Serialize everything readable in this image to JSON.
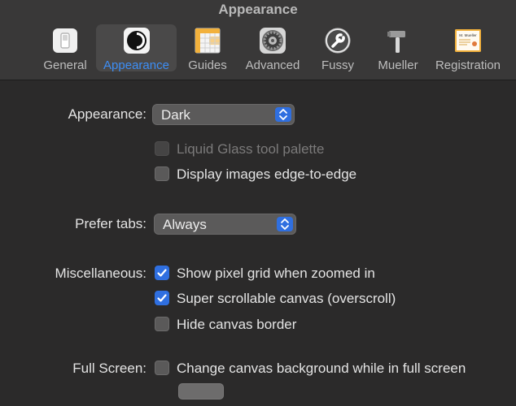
{
  "window": {
    "title": "Appearance"
  },
  "toolbar": {
    "tabs": [
      {
        "label": "General",
        "icon": "switch-icon",
        "active": false
      },
      {
        "label": "Appearance",
        "icon": "contrast-icon",
        "active": true
      },
      {
        "label": "Guides",
        "icon": "grid-sheet-icon",
        "active": false
      },
      {
        "label": "Advanced",
        "icon": "gear-icon",
        "active": false
      },
      {
        "label": "Fussy",
        "icon": "wrench-icon",
        "active": false
      },
      {
        "label": "Mueller",
        "icon": "hammer-icon",
        "active": false
      },
      {
        "label": "Registration",
        "icon": "certificate-icon",
        "active": false
      }
    ],
    "certificate_text": "M. Mueller"
  },
  "appearance": {
    "label": "Appearance:",
    "value": "Dark",
    "liquid_glass": {
      "label": "Liquid Glass tool palette",
      "checked": false,
      "enabled": false
    },
    "edge_to_edge": {
      "label": "Display images edge-to-edge",
      "checked": false,
      "enabled": true
    }
  },
  "tabs_pref": {
    "label": "Prefer tabs:",
    "value": "Always"
  },
  "misc": {
    "label": "Miscellaneous:",
    "pixel_grid": {
      "label": "Show pixel grid when zoomed in",
      "checked": true
    },
    "overscroll": {
      "label": "Super scrollable canvas (overscroll)",
      "checked": true
    },
    "hide_border": {
      "label": "Hide canvas border",
      "checked": false
    }
  },
  "fullscreen": {
    "label": "Full Screen:",
    "change_bg": {
      "label": "Change canvas background while in full screen",
      "checked": false
    }
  },
  "colors": {
    "accent": "#2f6fe0",
    "active_tab_text": "#3d8ef5",
    "background": "#2b2a2a",
    "toolbar": "#393838"
  }
}
